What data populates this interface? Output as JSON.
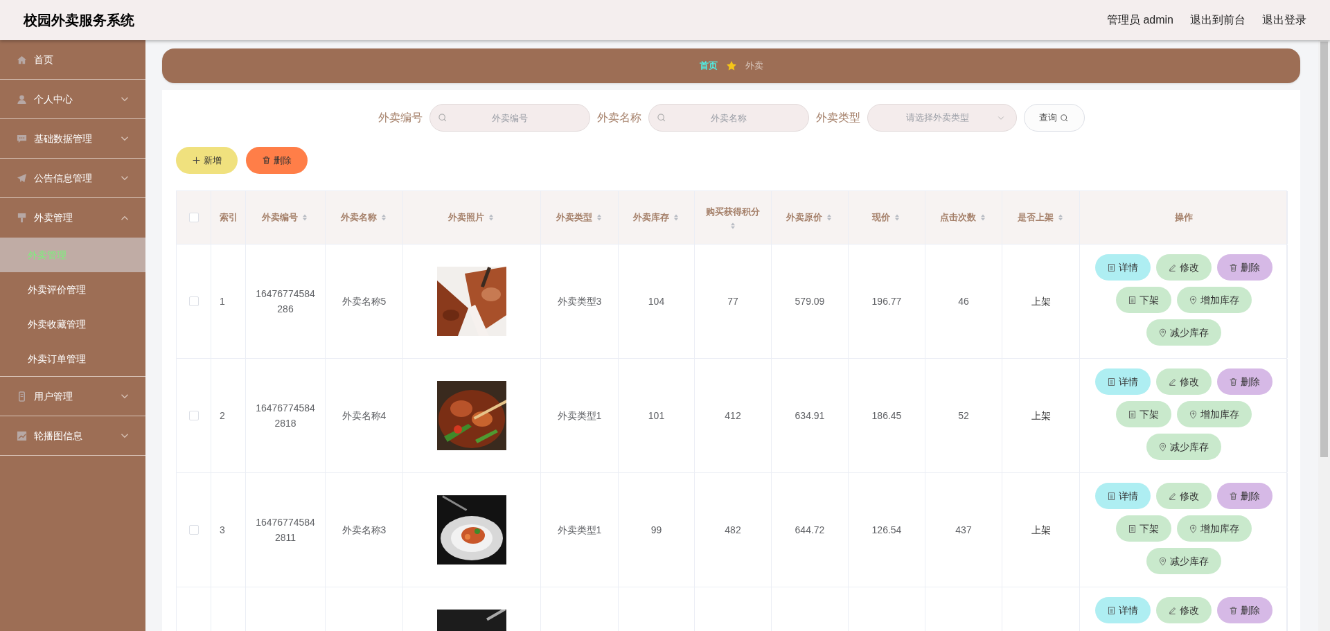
{
  "app_title": "校园外卖服务系统",
  "header_links": [
    "管理员 admin",
    "退出到前台",
    "退出登录"
  ],
  "sidebar": {
    "items": [
      {
        "label": "首页"
      },
      {
        "label": "个人中心",
        "expanded": false
      },
      {
        "label": "基础数据管理",
        "expanded": false
      },
      {
        "label": "公告信息管理",
        "expanded": false
      },
      {
        "label": "外卖管理",
        "expanded": true,
        "children": [
          {
            "label": "外卖管理",
            "selected": true
          },
          {
            "label": "外卖评价管理",
            "selected": false
          },
          {
            "label": "外卖收藏管理",
            "selected": false
          },
          {
            "label": "外卖订单管理",
            "selected": false
          }
        ]
      },
      {
        "label": "用户管理",
        "expanded": false
      },
      {
        "label": "轮播图信息",
        "expanded": false
      }
    ]
  },
  "breadcrumb": [
    "首页",
    "外卖"
  ],
  "search": {
    "fields": [
      {
        "kind": "input",
        "label": "外卖编号",
        "placeholder": "外卖编号"
      },
      {
        "kind": "input",
        "label": "外卖名称",
        "placeholder": "外卖名称"
      },
      {
        "kind": "select",
        "label": "外卖类型",
        "placeholder": "请选择外卖类型"
      }
    ],
    "button": "查询"
  },
  "toolbar": [
    {
      "kind": "add",
      "label": "新增"
    },
    {
      "kind": "delete",
      "label": "删除"
    }
  ],
  "table": {
    "select_all_checked": false,
    "columns": [
      {
        "label": "索引",
        "sortable": false
      },
      {
        "label": "外卖编号",
        "sortable": true
      },
      {
        "label": "外卖名称",
        "sortable": true
      },
      {
        "label": "外卖照片",
        "sortable": true
      },
      {
        "label": "外卖类型",
        "sortable": true
      },
      {
        "label": "外卖库存",
        "sortable": true
      },
      {
        "label": "购买获得积分",
        "sortable": true
      },
      {
        "label": "外卖原价",
        "sortable": true
      },
      {
        "label": "现价",
        "sortable": true
      },
      {
        "label": "点击次数",
        "sortable": true
      },
      {
        "label": "是否上架",
        "sortable": true
      },
      {
        "label": "操作",
        "sortable": false
      }
    ],
    "rows": [
      {
        "checked": false,
        "index": "1",
        "code": "16476774584286",
        "name": "外卖名称5",
        "photo": {
          "kind": "picture"
        },
        "type": "外卖类型3",
        "stock": "104",
        "points": "77",
        "original_price": "579.09",
        "price": "196.77",
        "clicks": "46",
        "on_shelf": "上架",
        "actions": [
          {
            "kind": "detail",
            "label": "详情"
          },
          {
            "kind": "edit",
            "label": "修改"
          },
          {
            "kind": "delete",
            "label": "删除"
          },
          {
            "kind": "off",
            "label": "下架"
          },
          {
            "kind": "add_stock",
            "label": "增加库存"
          },
          {
            "kind": "reduce_stock",
            "label": "减少库存"
          }
        ]
      },
      {
        "checked": false,
        "index": "2",
        "code": "164767745842818",
        "name": "外卖名称4",
        "photo": {
          "kind": "picture"
        },
        "type": "外卖类型1",
        "stock": "101",
        "points": "412",
        "original_price": "634.91",
        "price": "186.45",
        "clicks": "52",
        "on_shelf": "上架",
        "actions": [
          {
            "kind": "detail",
            "label": "详情"
          },
          {
            "kind": "edit",
            "label": "修改"
          },
          {
            "kind": "delete",
            "label": "删除"
          },
          {
            "kind": "off",
            "label": "下架"
          },
          {
            "kind": "add_stock",
            "label": "增加库存"
          },
          {
            "kind": "reduce_stock",
            "label": "减少库存"
          }
        ]
      },
      {
        "checked": false,
        "index": "3",
        "code": "164767745842811",
        "name": "外卖名称3",
        "photo": {
          "kind": "picture"
        },
        "type": "外卖类型1",
        "stock": "99",
        "points": "482",
        "original_price": "644.72",
        "price": "126.54",
        "clicks": "437",
        "on_shelf": "上架",
        "actions": [
          {
            "kind": "detail",
            "label": "详情"
          },
          {
            "kind": "edit",
            "label": "修改"
          },
          {
            "kind": "delete",
            "label": "删除"
          },
          {
            "kind": "off",
            "label": "下架"
          },
          {
            "kind": "add_stock",
            "label": "增加库存"
          },
          {
            "kind": "reduce_stock",
            "label": "减少库存"
          }
        ]
      },
      {
        "photo": {
          "kind": "picture"
        },
        "actions": [
          {
            "kind": "detail",
            "label": "详情"
          },
          {
            "kind": "edit",
            "label": "修改"
          },
          {
            "kind": "delete",
            "label": "删除"
          }
        ]
      }
    ]
  }
}
